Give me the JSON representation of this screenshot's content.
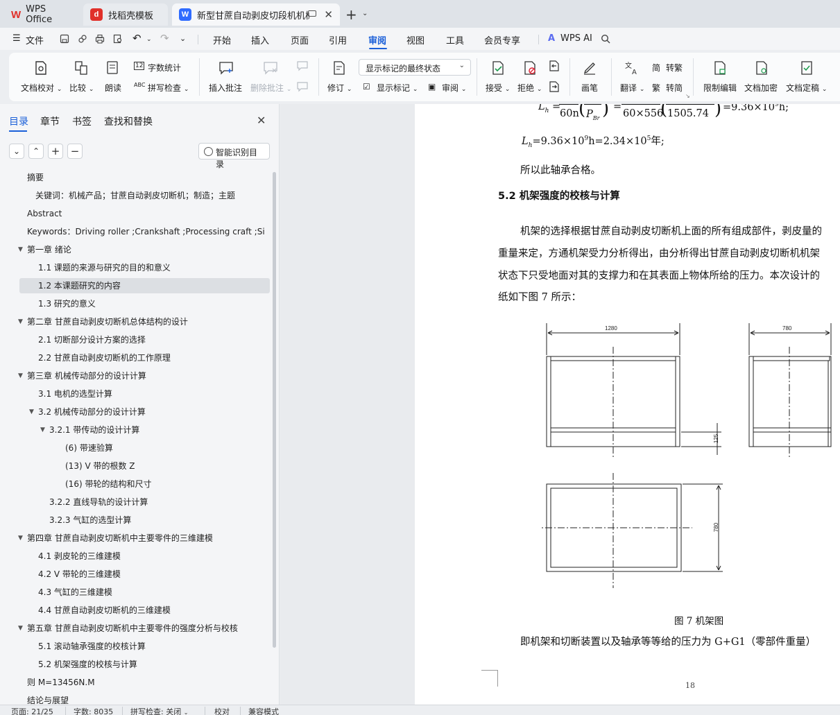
{
  "tabs": [
    {
      "label": "WPS Office",
      "icon": "wps-logo-icon",
      "color": "#e0302a"
    },
    {
      "label": "找稻壳模板",
      "icon": "docer-icon",
      "color": "#e0302a"
    },
    {
      "label": "新型甘蔗自动剥皮切段机机械",
      "icon": "writer-doc-icon",
      "color": "#2f6bff"
    }
  ],
  "menu": {
    "file": "文件",
    "items": [
      "开始",
      "插入",
      "页面",
      "引用",
      "审阅",
      "视图",
      "工具",
      "会员专享"
    ],
    "active": "审阅",
    "ai": "WPS AI"
  },
  "ribbon": {
    "doc_check": "文档校对",
    "compare": "比较",
    "read_aloud": "朗读",
    "word_count": "字数统计",
    "spell_check": "拼写检查",
    "insert_comment": "插入批注",
    "delete_comment": "删除批注",
    "revise": "修订",
    "markup_state": "显示标记的最终状态",
    "show_markup": "显示标记",
    "review": "审阅",
    "accept": "接受",
    "reject": "拒绝",
    "pen": "画笔",
    "translate": "翻译",
    "to_traditional": "转繁",
    "to_simplified": "转简",
    "restrict_edit": "限制编辑",
    "encrypt": "文档加密",
    "finalize": "文档定稿"
  },
  "nav": {
    "tabs": [
      "目录",
      "章节",
      "书签",
      "查找和替换"
    ],
    "smart_btn": "智能识别目录",
    "toc": [
      {
        "label": "摘要",
        "level": 0
      },
      {
        "label": "关键词：机械产品；甘蔗自动剥皮切断机；制造；主题",
        "level": 0.5
      },
      {
        "label": "Abstract",
        "level": 0
      },
      {
        "label": "Keywords：Driving roller ;Crankshaft ;Processing craft ;Si ...",
        "level": 0
      },
      {
        "label": "第一章  绪论",
        "level": 0,
        "toggle": "▼"
      },
      {
        "label": "1.1  课题的来源与研究的目的和意义",
        "level": 1
      },
      {
        "label": "1.2  本课题研究的内容",
        "level": 1,
        "selected": true
      },
      {
        "label": "1.3  研究的意义",
        "level": 1
      },
      {
        "label": "第二章  甘蔗自动剥皮切断机总体结构的设计",
        "level": 0,
        "toggle": "▼"
      },
      {
        "label": "2.1 切断部分设计方案的选择",
        "level": 1
      },
      {
        "label": "2.2 甘蔗自动剥皮切断机的工作原理",
        "level": 1
      },
      {
        "label": "第三章  机械传动部分的设计计算",
        "level": 0,
        "toggle": "▼"
      },
      {
        "label": "3.1 电机的选型计算",
        "level": 1
      },
      {
        "label": "3.2  机械传动部分的设计计算",
        "level": 1,
        "toggle": "▼"
      },
      {
        "label": "3.2.1  带传动的设计计算",
        "level": 2,
        "toggle": "▼"
      },
      {
        "label": "(6)  带速验算",
        "level": 3
      },
      {
        "label": "(13)  V 带的根数 Z",
        "level": 3
      },
      {
        "label": "(16)  带轮的结构和尺寸",
        "level": 3
      },
      {
        "label": "3.2.2 直线导轨的设计计算",
        "level": 2
      },
      {
        "label": "3.2.3  气缸的选型计算",
        "level": 2
      },
      {
        "label": "第四章  甘蔗自动剥皮切断机中主要零件的三维建模",
        "level": 0,
        "toggle": "▼"
      },
      {
        "label": "4.1 剥皮轮的三维建模",
        "level": 1
      },
      {
        "label": "4.2 V 带轮的三维建模",
        "level": 1
      },
      {
        "label": "4.3 气缸的三维建模",
        "level": 1
      },
      {
        "label": "4.4 甘蔗自动剥皮切断机的三维建模",
        "level": 1
      },
      {
        "label": "第五章  甘蔗自动剥皮切断机中主要零件的强度分析与校核",
        "level": 0,
        "toggle": "▼"
      },
      {
        "label": "5.1 滚动轴承强度的校核计算",
        "level": 1
      },
      {
        "label": "5.2 机架强度的校核与计算",
        "level": 1
      },
      {
        "label": "则 M=13456N.M",
        "level": 0
      },
      {
        "label": "结论与展望",
        "level": 0
      }
    ]
  },
  "doc": {
    "formula_top": {
      "lh": "L",
      "lh_sub": "h",
      "eq1": "=",
      "frac_den1": "60n",
      "pbr": "P",
      "pbr_sub": "Br",
      "eq2": "=",
      "frac_den2": "60×556",
      "paren_val": "1505.74",
      "result": "=9.36×10",
      "result_exp": "9",
      "unit": "h;"
    },
    "formula_line2": {
      "lh": "L",
      "lh_sub": "h",
      "text": "=9.36×10",
      "exp1": "9",
      "text2": "h=2.34×10",
      "exp2": "5",
      "text3": "年;"
    },
    "qualified": "所以此轴承合格。",
    "heading": "5.2 机架强度的校核与计算",
    "para": [
      "机架的选择根据甘蔗自动剥皮切断机上面的所有组成部件，剥皮量的",
      "重量来定，方通机架受力分析得出，由分析得出甘蔗自动剥皮切断机机架",
      "状态下只受地面对其的支撑力和在其表面上物体所给的压力。本次设计的",
      "纸如下图 7 所示："
    ],
    "dim_1280": "1280",
    "dim_780_top": "780",
    "dim_125": "125",
    "dim_780_side": "780",
    "caption": "图 7 机架图",
    "after_caption": "即机架和切断装置以及轴承等等给的压力为 G+G1（零部件重量）",
    "page_number": "18"
  },
  "status": {
    "page": "页面: 21/25",
    "words": "字数: 8035",
    "spell": "拼写检查: 关闭",
    "proof": "校对",
    "compat": "兼容模式"
  }
}
